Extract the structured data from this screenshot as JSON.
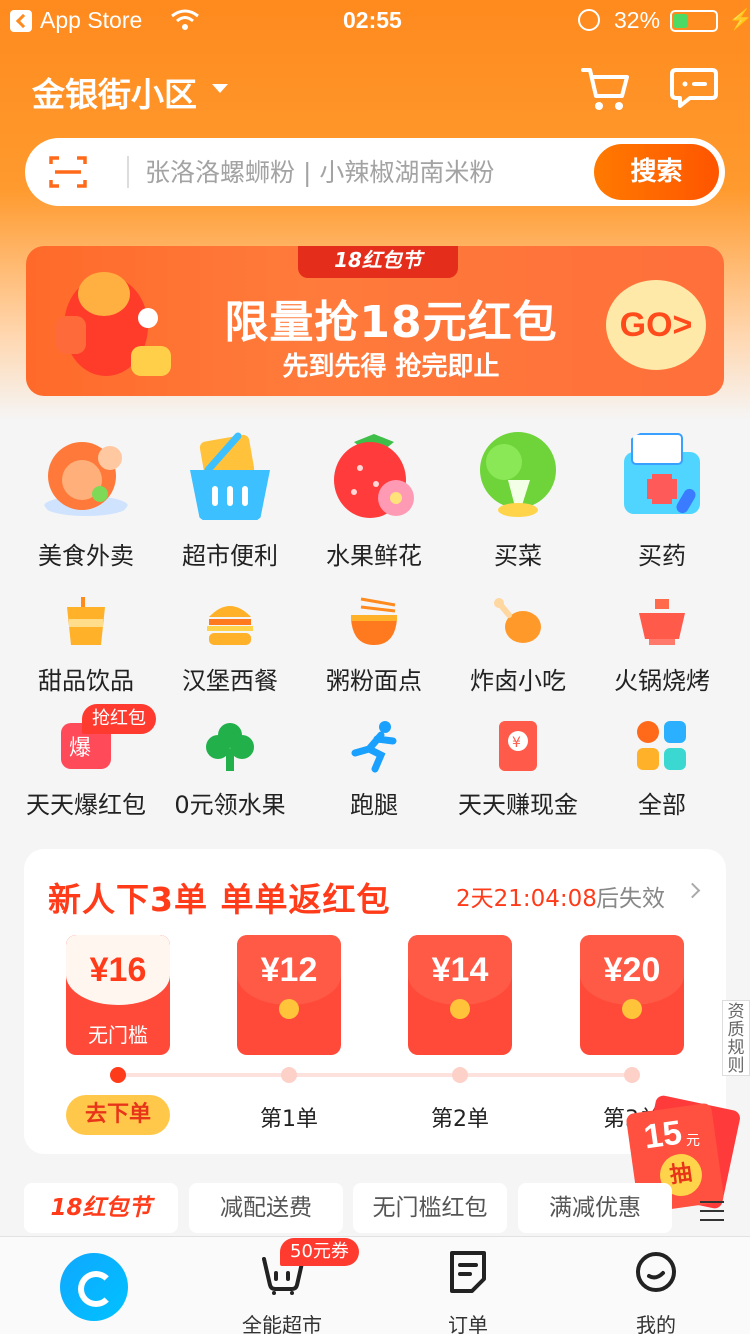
{
  "status_bar": {
    "back_app": "App Store",
    "time": "02:55",
    "battery": "32%"
  },
  "header": {
    "location": "金银街小区"
  },
  "search": {
    "placeholder": "张洛洛螺蛳粉 | 小辣椒湖南米粉",
    "button": "搜索"
  },
  "banner": {
    "tag": "18红包节",
    "headline": "限量抢18元红包",
    "sub": "先到先得 抢完即止",
    "cta": "GO>"
  },
  "categories_main": [
    {
      "label": "美食外卖",
      "icon": "food-delivery-icon"
    },
    {
      "label": "超市便利",
      "icon": "supermarket-basket-icon"
    },
    {
      "label": "水果鲜花",
      "icon": "strawberry-flower-icon"
    },
    {
      "label": "买菜",
      "icon": "vegetable-icon"
    },
    {
      "label": "买药",
      "icon": "medicine-box-icon"
    }
  ],
  "categories_small": [
    {
      "label": "甜品饮品",
      "icon": "drink-cup-icon"
    },
    {
      "label": "汉堡西餐",
      "icon": "burger-icon"
    },
    {
      "label": "粥粉面点",
      "icon": "noodle-bowl-icon"
    },
    {
      "label": "炸卤小吃",
      "icon": "drumstick-icon"
    },
    {
      "label": "火锅烧烤",
      "icon": "hotpot-icon"
    },
    {
      "label": "天天爆红包",
      "icon": "red-packet-burst-icon"
    },
    {
      "label": "0元领水果",
      "icon": "tree-icon"
    },
    {
      "label": "跑腿",
      "icon": "runner-icon"
    },
    {
      "label": "天天赚现金",
      "icon": "cash-envelope-icon"
    },
    {
      "label": "全部",
      "icon": "grid-all-icon"
    }
  ],
  "hot_badge": "抢红包",
  "new_user": {
    "title": "新人下3单 单单返红包",
    "timer": "2天21:04:08",
    "expire": "后失效",
    "packets": [
      {
        "amount": "¥16",
        "note": "无门槛"
      },
      {
        "amount": "¥12",
        "note": ""
      },
      {
        "amount": "¥14",
        "note": ""
      },
      {
        "amount": "¥20",
        "note": ""
      }
    ],
    "steps": [
      "去下单",
      "第1单",
      "第2单",
      "第3单"
    ]
  },
  "side_rule": "资质规则",
  "float_packet": {
    "amount": "15",
    "unit": "元",
    "action": "抽"
  },
  "filters": [
    "18红包节",
    "减配送费",
    "无门槛红包",
    "满减优惠"
  ],
  "bottom_nav": {
    "items": [
      {
        "label": "全能超市",
        "icon": "basket-icon"
      },
      {
        "label": "订单",
        "icon": "order-icon"
      },
      {
        "label": "我的",
        "icon": "profile-icon"
      }
    ],
    "coupon_badge": "50元券"
  },
  "colors": {
    "primary_orange": "#ff8a1e",
    "accent_red": "#ff3b1a",
    "home_blue": "#10a7ff"
  }
}
